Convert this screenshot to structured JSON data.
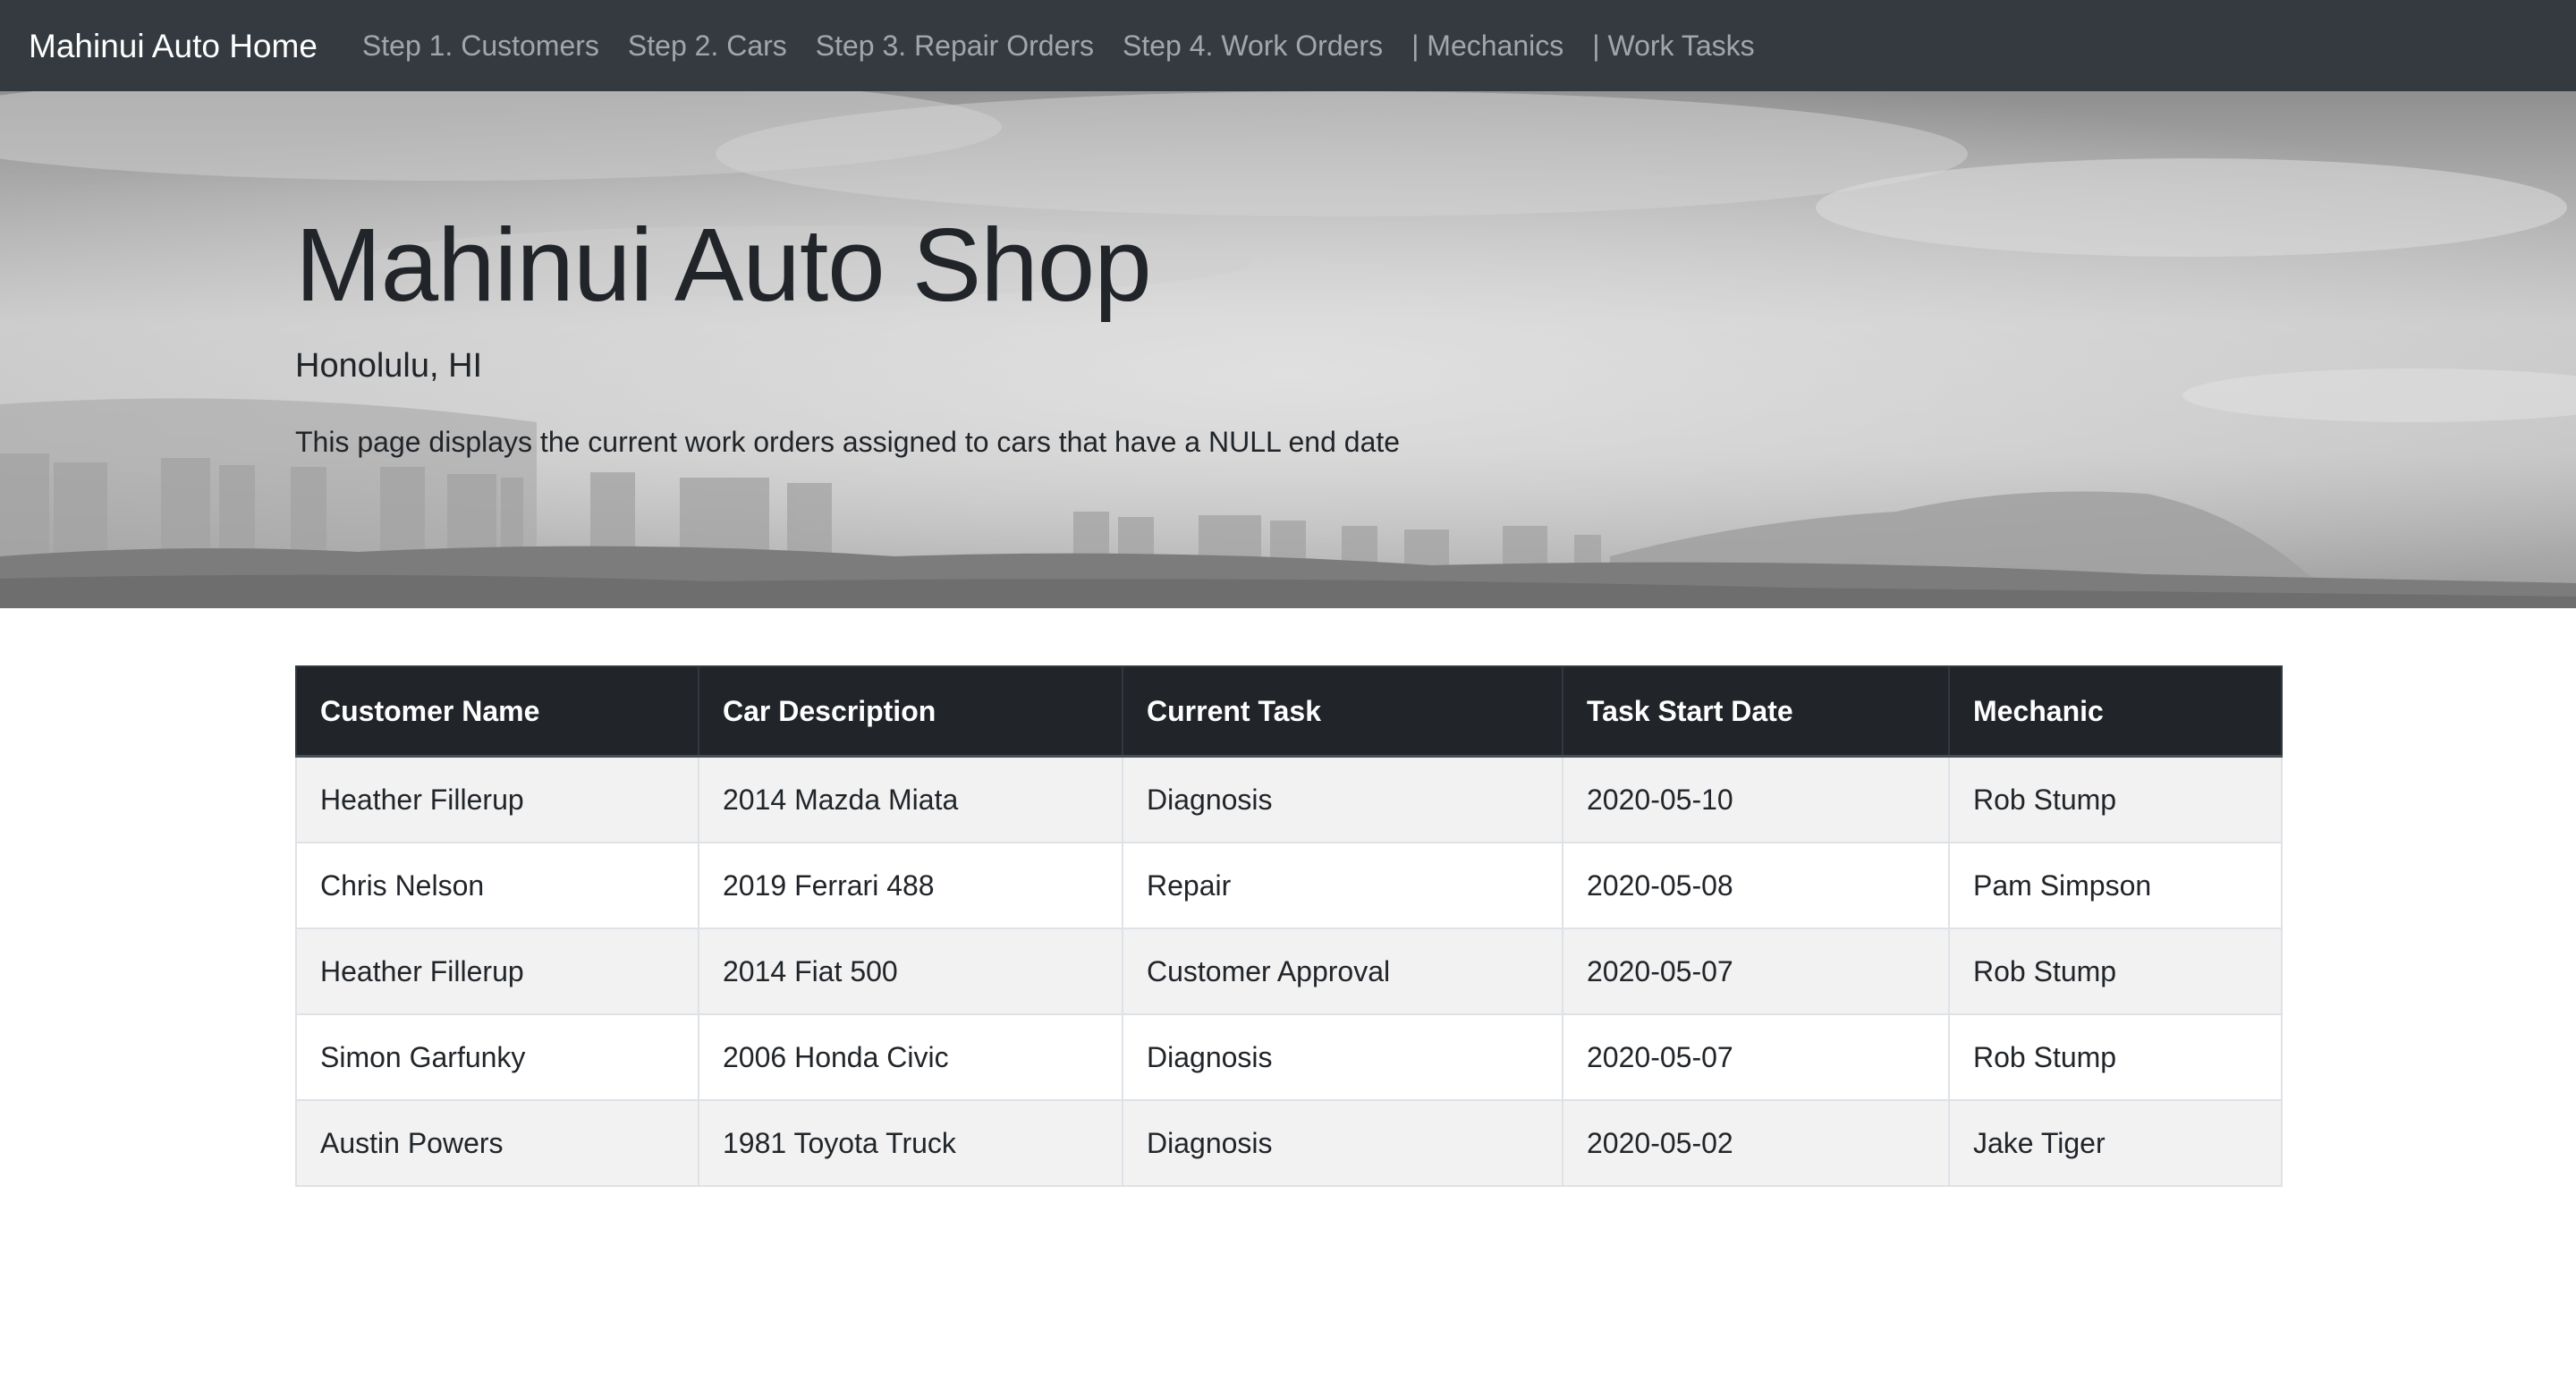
{
  "navbar": {
    "brand": "Mahinui Auto Home",
    "links": [
      {
        "label": "Step 1. Customers"
      },
      {
        "label": "Step 2. Cars"
      },
      {
        "label": "Step 3. Repair Orders"
      },
      {
        "label": "Step 4. Work Orders"
      },
      {
        "label": "| Mechanics"
      },
      {
        "label": "| Work Tasks"
      }
    ]
  },
  "hero": {
    "title": "Mahinui Auto Shop",
    "subtitle": "Honolulu, HI",
    "description": "This page displays the current work orders assigned to cars that have a NULL end date"
  },
  "table": {
    "headers": [
      "Customer Name",
      "Car Description",
      "Current Task",
      "Task Start Date",
      "Mechanic"
    ],
    "rows": [
      [
        "Heather Fillerup",
        "2014 Mazda Miata",
        "Diagnosis",
        "2020-05-10",
        "Rob Stump"
      ],
      [
        "Chris Nelson",
        "2019 Ferrari 488",
        "Repair",
        "2020-05-08",
        "Pam Simpson"
      ],
      [
        "Heather Fillerup",
        "2014 Fiat 500",
        "Customer Approval",
        "2020-05-07",
        "Rob Stump"
      ],
      [
        "Simon Garfunky",
        "2006 Honda Civic",
        "Diagnosis",
        "2020-05-07",
        "Rob Stump"
      ],
      [
        "Austin Powers",
        "1981 Toyota Truck",
        "Diagnosis",
        "2020-05-02",
        "Jake Tiger"
      ]
    ]
  },
  "colors": {
    "navbar_bg": "#343a40",
    "table_header_bg": "#212529",
    "stripe_bg": "#f2f2f2"
  }
}
